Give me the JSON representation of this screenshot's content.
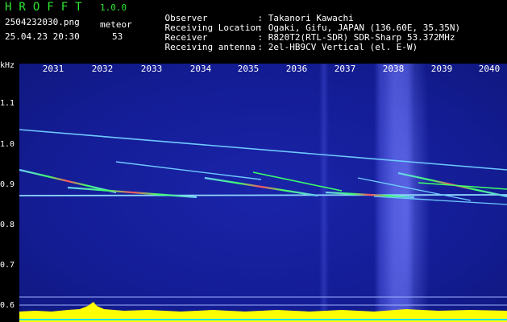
{
  "app": {
    "title": "HROFFT",
    "version": "1.0.0",
    "file_name": "2504232030.png",
    "date_time": "25.04.23 20:30",
    "meteor_label": "meteor",
    "meteor_count": "53"
  },
  "info": [
    {
      "label": "Observer",
      "value": ": Takanori Kawachi"
    },
    {
      "label": "Receiving Location",
      "value": ": Ogaki, Gifu, JAPAN (136.60E, 35.35N)"
    },
    {
      "label": "Receiver",
      "value": ": R820T2(RTL-SDR) SDR-Sharp 53.372MHz"
    },
    {
      "label": "Receiving antenna",
      "value": ": 2el-HB9CV Vertical (el. E-W)"
    }
  ],
  "axis": {
    "unit": "kHz",
    "y_ticks": [
      "1.1",
      "1.0",
      "0.9",
      "0.8",
      "0.7",
      "0.6"
    ],
    "x_ticks": [
      "2031",
      "2032",
      "2033",
      "2034",
      "2035",
      "2036",
      "2037",
      "2038",
      "2039",
      "2040"
    ]
  },
  "colors": {
    "title_green": "#2ee82e",
    "background_blue": "#141d96",
    "signal_line": "#6fc9ff",
    "echo_hot": "#ff5060",
    "echo_warm": "#3cff6a",
    "level_bar": "#ffff00"
  }
}
